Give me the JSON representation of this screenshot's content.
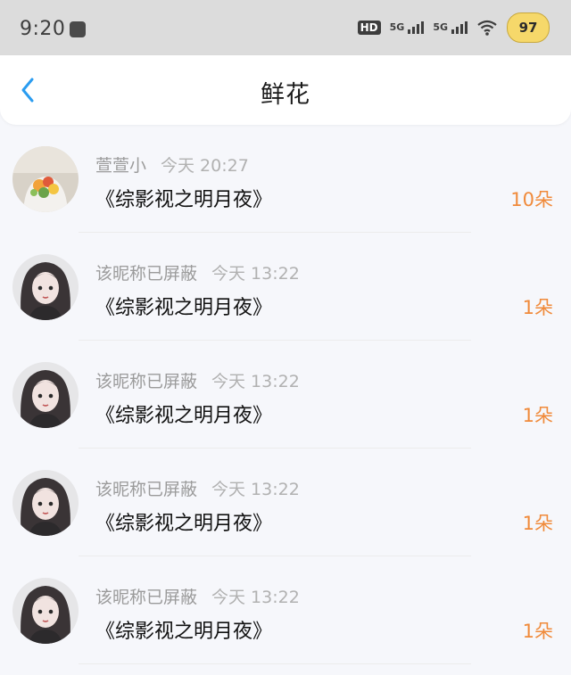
{
  "status_bar": {
    "time": "9:20",
    "hd": "HD",
    "signal1": "5G",
    "signal2": "5G",
    "battery": "97"
  },
  "header": {
    "title": "鲜花"
  },
  "gifts": [
    {
      "name": "萱萱小",
      "time": "今天 20:27",
      "book": "《综影视之明月夜》",
      "count": "10朵"
    },
    {
      "name": "该昵称已屏蔽",
      "time": "今天 13:22",
      "book": "《综影视之明月夜》",
      "count": "1朵"
    },
    {
      "name": "该昵称已屏蔽",
      "time": "今天 13:22",
      "book": "《综影视之明月夜》",
      "count": "1朵"
    },
    {
      "name": "该昵称已屏蔽",
      "time": "今天 13:22",
      "book": "《综影视之明月夜》",
      "count": "1朵"
    },
    {
      "name": "该昵称已屏蔽",
      "time": "今天 13:22",
      "book": "《综影视之明月夜》",
      "count": "1朵"
    }
  ],
  "colors": {
    "accent": "#2a9cf0",
    "count": "#f08a3a"
  }
}
